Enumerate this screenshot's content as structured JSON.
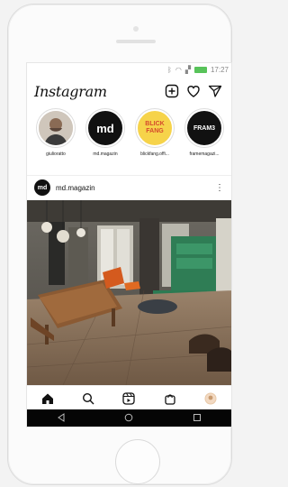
{
  "app": {
    "title": "Instagram"
  },
  "status": {
    "time": "17:27"
  },
  "stories": [
    {
      "label": "giulioratto",
      "initials": "",
      "bg": "#d8d0c6",
      "fg": "#333"
    },
    {
      "label": "md.magazin",
      "initials": "md",
      "bg": "#111111",
      "fg": "#ffffff"
    },
    {
      "label": "blickfang.offi...",
      "initials": "BLICK FANG",
      "bg": "#f6d34a",
      "fg": "#d54a2c"
    },
    {
      "label": "framemagazi...",
      "initials": "FRAM3",
      "bg": "#111111",
      "fg": "#ffffff"
    }
  ],
  "post": {
    "username": "md.magazin",
    "avatar_text": "md",
    "more": "⋮"
  },
  "icons": {
    "add": "plus-square-icon",
    "heart": "heart-icon",
    "send": "paper-plane-icon",
    "home": "home-icon",
    "search": "search-icon",
    "reels": "reels-icon",
    "shop": "shopping-bag-icon",
    "profile": "profile-avatar-icon",
    "back": "back-triangle-icon",
    "home_nav": "home-circle-icon",
    "recent": "recent-square-icon"
  },
  "colors": {
    "accent": "#58c35a",
    "text": "#111111"
  }
}
